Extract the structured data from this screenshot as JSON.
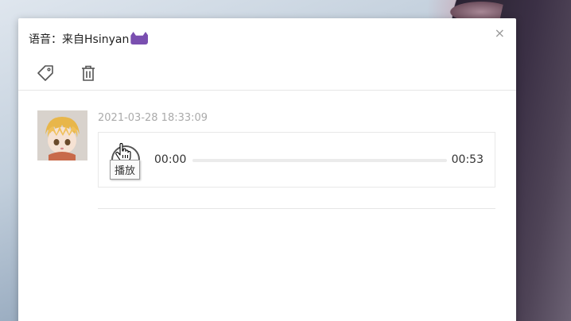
{
  "dialog": {
    "title": "语音：来自Hsinyan",
    "title_emoji": "purple-monster-emoji",
    "close_label": "×"
  },
  "toolbar": {
    "tag_icon": "tag-icon",
    "delete_icon": "trash-icon"
  },
  "message": {
    "timestamp": "2021-03-28 18:33:09",
    "avatar": "anime-character-avatar"
  },
  "player": {
    "current_time": "00:00",
    "total_time": "00:53",
    "progress_fraction": 0,
    "play_tooltip": "播放"
  },
  "colors": {
    "text_muted": "#aaaaaa",
    "border": "#e8e8e8",
    "icon": "#555555"
  }
}
